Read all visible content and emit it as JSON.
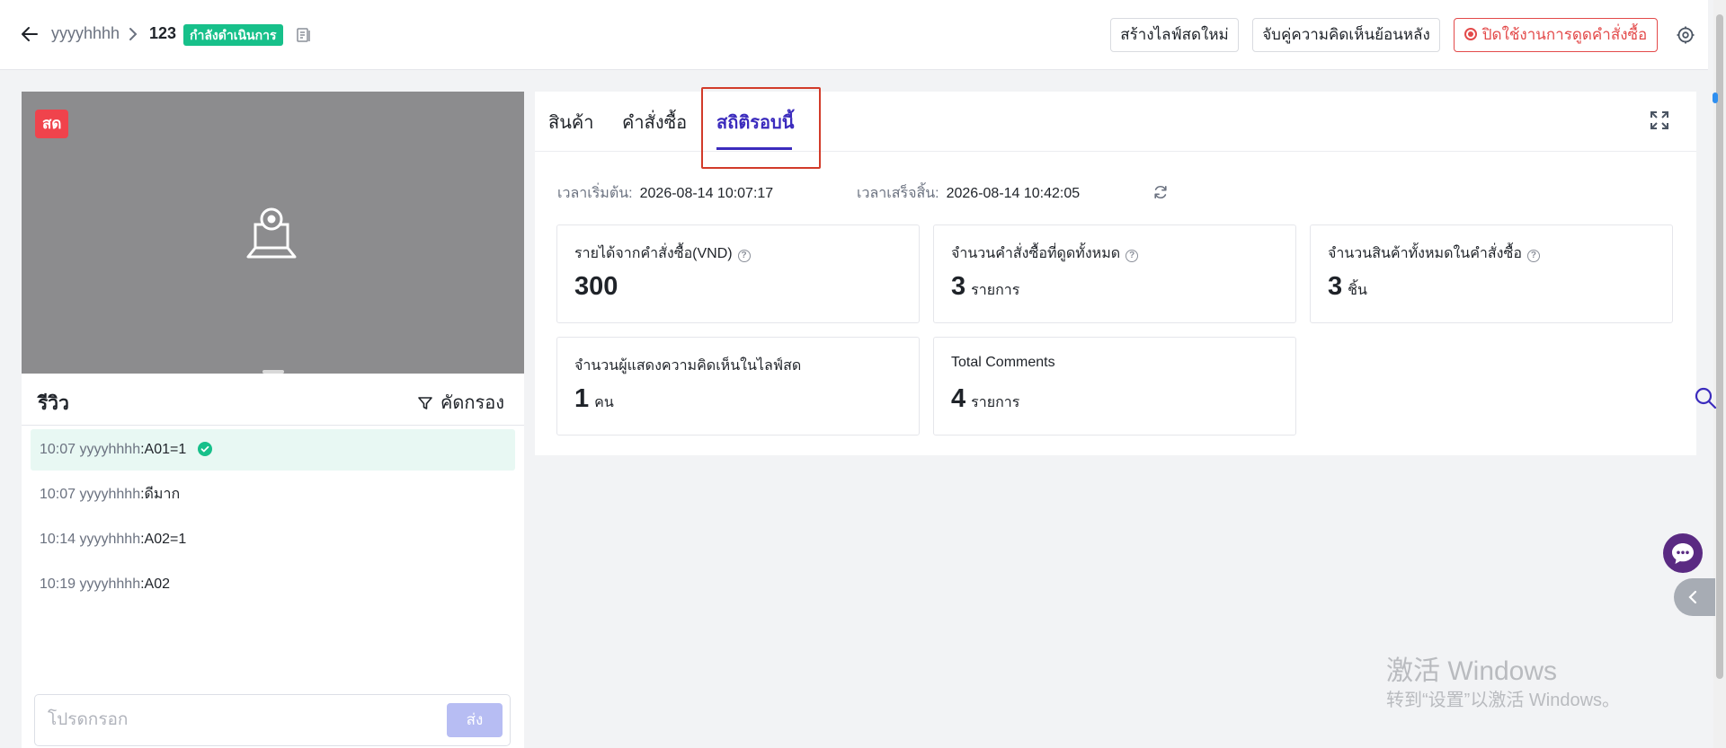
{
  "header": {
    "breadcrumb_user": "yyyyhhhh",
    "breadcrumb_id": "123",
    "status": "กำลังดำเนินการ",
    "btn_new_live": "สร้างไลฟ์สดใหม่",
    "btn_match_comments": "จับคู่ความคิดเห็นย้อนหลัง",
    "btn_disable_order_capture": "ปิดใช้งานการดูดคำสั่งซื้อ"
  },
  "video": {
    "live_badge": "สด"
  },
  "reviews": {
    "title": "รีวิว",
    "filter_label": "คัดกรอง",
    "comments": [
      {
        "time": "10:07",
        "user": "yyyyhhhh",
        "text": ":A01=1",
        "selected": true
      },
      {
        "time": "10:07",
        "user": "yyyyhhhh",
        "text": ":ดีมาก",
        "selected": false
      },
      {
        "time": "10:14",
        "user": "yyyyhhhh",
        "text": ":A02=1",
        "selected": false
      },
      {
        "time": "10:19",
        "user": "yyyyhhhh",
        "text": ":A02",
        "selected": false
      }
    ],
    "input_placeholder": "โปรดกรอก",
    "send_label": "ส่ง"
  },
  "tabs": {
    "products": "สินค้า",
    "orders": "คำสั่งซื้อ",
    "stats": "สถิติรอบนี้",
    "active": "stats"
  },
  "times": {
    "start_label": "เวลาเริ่มต้น:",
    "start_value": "2026-08-14 10:07:17",
    "end_label": "เวลาเสร็จสิ้น:",
    "end_value": "2026-08-14 10:42:05"
  },
  "stats": {
    "revenue": {
      "label": "รายได้จากคำสั่งซื้อ(VND)",
      "value": "300",
      "unit": ""
    },
    "total_orders": {
      "label": "จำนวนคำสั่งซื้อที่ดูดทั้งหมด",
      "value": "3",
      "unit": "รายการ"
    },
    "total_items": {
      "label": "จำนวนสินค้าทั้งหมดในคำสั่งซื้อ",
      "value": "3",
      "unit": "ชิ้น"
    },
    "commenters": {
      "label": "จำนวนผู้แสดงความคิดเห็นในไลฟ์สด",
      "value": "1",
      "unit": "คน"
    },
    "total_comments": {
      "label": "Total Comments",
      "value": "4",
      "unit": "รายการ"
    }
  },
  "watermark": {
    "title": "激活 Windows",
    "subtitle": "转到“设置”以激活 Windows。"
  },
  "colors": {
    "accent": "#3b2bbd",
    "status_green": "#17c08a",
    "live_red": "#f0434c",
    "danger": "#e34a4a",
    "highlight_box": "#d23b2a"
  },
  "icons": {
    "back": "arrow-left-icon",
    "doc": "document-icon",
    "settings": "settings-icon",
    "camera": "camera-icon",
    "filter": "filter-icon",
    "check": "check-circle-icon",
    "fullscreen": "fullscreen-icon",
    "refresh": "refresh-icon",
    "help": "help-circle-icon",
    "search": "search-icon",
    "chat": "chat-icon",
    "collapse": "chevron-left-icon"
  }
}
